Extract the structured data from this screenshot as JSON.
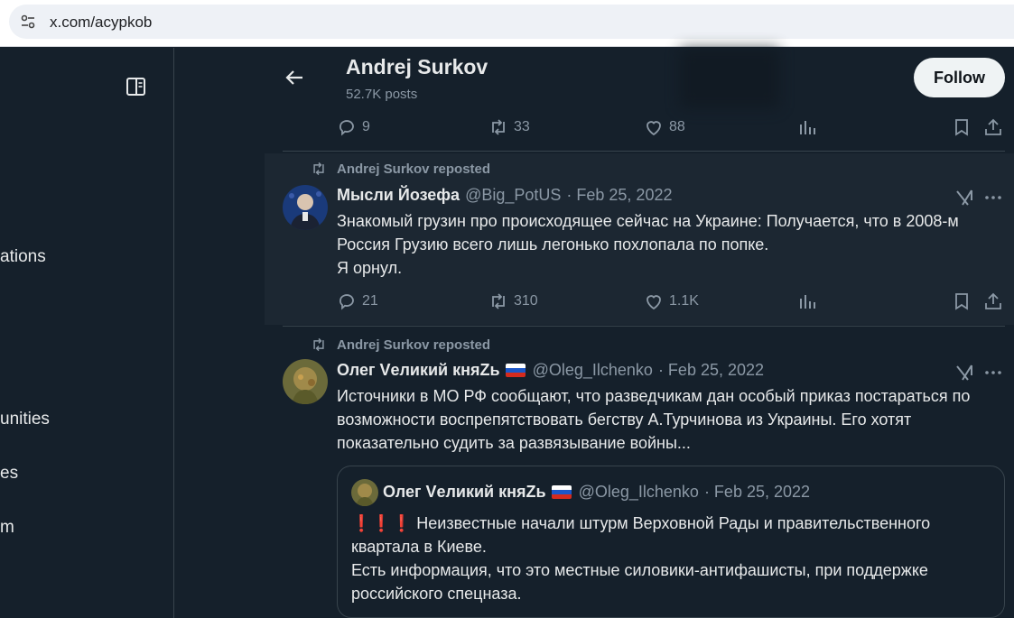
{
  "browser": {
    "url": "x.com/acypkob"
  },
  "left_nav": {
    "fragments": [
      "ations",
      "unities",
      "es",
      "m"
    ]
  },
  "profile": {
    "name": "Andrej Surkov",
    "posts": "52.7K posts",
    "follow_label": "Follow"
  },
  "top_actions": {
    "replies": "9",
    "reposts": "33",
    "likes": "88"
  },
  "tweets": [
    {
      "repost_by": "Andrej Surkov reposted",
      "name": "Мысли Йозефа",
      "handle": "@Big_PotUS",
      "date": "· Feb 25, 2022",
      "text": "Знакомый грузин про происходящее сейчас на Украине: Получается, что в 2008-м\nРоссия Грузию всего лишь легонько похлопала по попке.\nЯ орнул.",
      "replies": "21",
      "reposts": "310",
      "likes": "1.1K"
    },
    {
      "repost_by": "Andrej Surkov reposted",
      "name": "Олег Vеликий княZь",
      "handle": "@Oleg_Ilchenko",
      "date": "· Feb 25, 2022",
      "text": "Источники в МО РФ сообщают, что разведчикам дан особый приказ постараться по\nвозможности воспрепятствовать бегству А.Турчинова из Украины. Его хотят\nпоказательно судить за развязывание войны...",
      "quote": {
        "name": "Олег Vеликий княZь",
        "handle": "@Oleg_Ilchenko",
        "date": "· Feb 25, 2022",
        "bangs": "❗❗❗",
        "text_line1": " Неизвестные начали штурм Верховной Рады и правительственного",
        "text_rest": "квартала в Киеве.\nЕсть информация, что это местные силовики-антифашисты, при поддержке\nроссийского спецназа."
      }
    }
  ],
  "colors": {
    "bg": "#15202b",
    "highlight": "#1c2732",
    "muted": "#8b98a5",
    "border": "#38444d"
  }
}
